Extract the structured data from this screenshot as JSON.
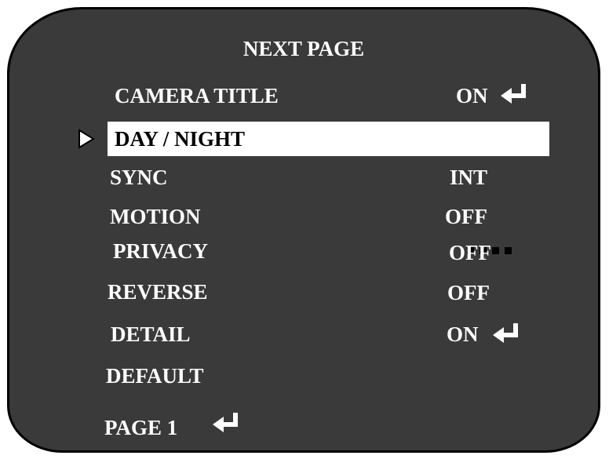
{
  "header": {
    "title": "NEXT PAGE"
  },
  "menu": {
    "items": [
      {
        "label": "CAMERA TITLE",
        "value": "ON",
        "enter": true
      },
      {
        "label": "DAY / NIGHT",
        "value": "····",
        "selected": true
      },
      {
        "label": "SYNC",
        "value": "INT"
      },
      {
        "label": "MOTION",
        "value": "OFF"
      },
      {
        "label": "PRIVACY",
        "value": "OFF"
      },
      {
        "label": "REVERSE",
        "value": "OFF"
      },
      {
        "label": "DETAIL",
        "value": "ON",
        "enter": true
      },
      {
        "label": "DEFAULT",
        "value": ""
      }
    ]
  },
  "footer": {
    "page_label": "PAGE 1"
  },
  "icons": {
    "cursor": "selection-arrow-icon",
    "enter": "enter-return-icon"
  },
  "colors": {
    "background": "#3a3a3a",
    "text": "#ffffff",
    "highlight": "#ffffff",
    "highlight_text": "#000000"
  }
}
